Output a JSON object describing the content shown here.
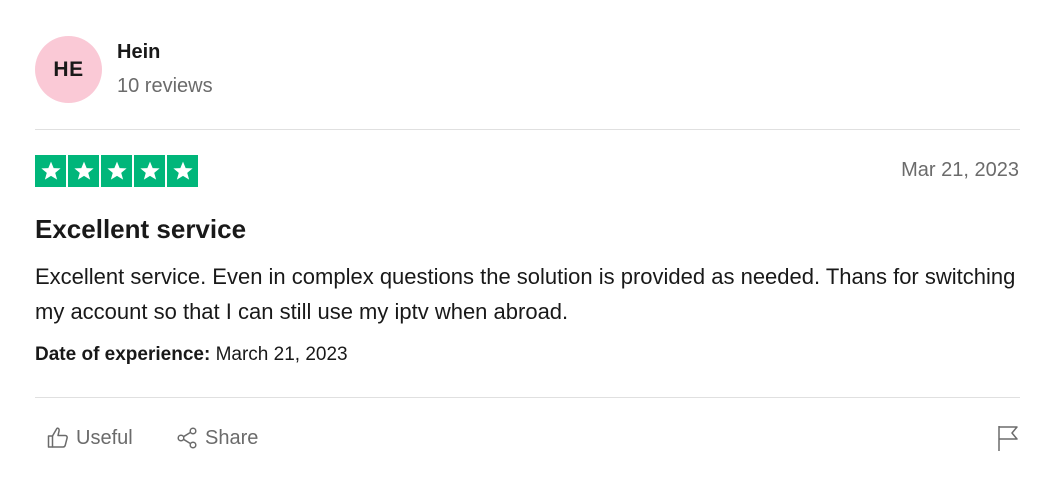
{
  "reviewer": {
    "initials": "HE",
    "name": "Hein",
    "reviews_count": "10 reviews"
  },
  "review": {
    "rating": 5,
    "max_rating": 5,
    "date": "Mar 21, 2023",
    "title": "Excellent service",
    "body": "Excellent service. Even in complex questions the solution is provided as needed. Thans for switching my account so that I can still use my iptv when abroad.",
    "experience_label": "Date of experience:",
    "experience_date": " March 21, 2023"
  },
  "actions": {
    "useful_label": "Useful",
    "share_label": "Share"
  },
  "icons": {
    "useful": "thumbs-up-icon",
    "share": "share-icon",
    "report": "flag-icon",
    "star": "star-icon"
  },
  "colors": {
    "star_bg": "#00b67a",
    "avatar_bg": "#fac9d6",
    "muted_text": "#6b6b6b",
    "primary_text": "#191919"
  }
}
